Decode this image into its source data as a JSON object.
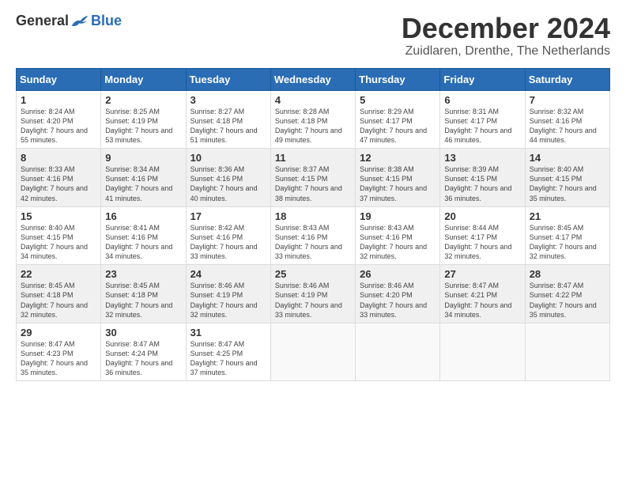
{
  "logo": {
    "general": "General",
    "blue": "Blue"
  },
  "header": {
    "month": "December 2024",
    "location": "Zuidlaren, Drenthe, The Netherlands"
  },
  "days": [
    "Sunday",
    "Monday",
    "Tuesday",
    "Wednesday",
    "Thursday",
    "Friday",
    "Saturday"
  ],
  "weeks": [
    [
      {
        "num": "1",
        "sunrise": "8:24 AM",
        "sunset": "4:20 PM",
        "daylight": "7 hours and 55 minutes."
      },
      {
        "num": "2",
        "sunrise": "8:25 AM",
        "sunset": "4:19 PM",
        "daylight": "7 hours and 53 minutes."
      },
      {
        "num": "3",
        "sunrise": "8:27 AM",
        "sunset": "4:18 PM",
        "daylight": "7 hours and 51 minutes."
      },
      {
        "num": "4",
        "sunrise": "8:28 AM",
        "sunset": "4:18 PM",
        "daylight": "7 hours and 49 minutes."
      },
      {
        "num": "5",
        "sunrise": "8:29 AM",
        "sunset": "4:17 PM",
        "daylight": "7 hours and 47 minutes."
      },
      {
        "num": "6",
        "sunrise": "8:31 AM",
        "sunset": "4:17 PM",
        "daylight": "7 hours and 46 minutes."
      },
      {
        "num": "7",
        "sunrise": "8:32 AM",
        "sunset": "4:16 PM",
        "daylight": "7 hours and 44 minutes."
      }
    ],
    [
      {
        "num": "8",
        "sunrise": "8:33 AM",
        "sunset": "4:16 PM",
        "daylight": "7 hours and 42 minutes."
      },
      {
        "num": "9",
        "sunrise": "8:34 AM",
        "sunset": "4:16 PM",
        "daylight": "7 hours and 41 minutes."
      },
      {
        "num": "10",
        "sunrise": "8:36 AM",
        "sunset": "4:16 PM",
        "daylight": "7 hours and 40 minutes."
      },
      {
        "num": "11",
        "sunrise": "8:37 AM",
        "sunset": "4:15 PM",
        "daylight": "7 hours and 38 minutes."
      },
      {
        "num": "12",
        "sunrise": "8:38 AM",
        "sunset": "4:15 PM",
        "daylight": "7 hours and 37 minutes."
      },
      {
        "num": "13",
        "sunrise": "8:39 AM",
        "sunset": "4:15 PM",
        "daylight": "7 hours and 36 minutes."
      },
      {
        "num": "14",
        "sunrise": "8:40 AM",
        "sunset": "4:15 PM",
        "daylight": "7 hours and 35 minutes."
      }
    ],
    [
      {
        "num": "15",
        "sunrise": "8:40 AM",
        "sunset": "4:15 PM",
        "daylight": "7 hours and 34 minutes."
      },
      {
        "num": "16",
        "sunrise": "8:41 AM",
        "sunset": "4:16 PM",
        "daylight": "7 hours and 34 minutes."
      },
      {
        "num": "17",
        "sunrise": "8:42 AM",
        "sunset": "4:16 PM",
        "daylight": "7 hours and 33 minutes."
      },
      {
        "num": "18",
        "sunrise": "8:43 AM",
        "sunset": "4:16 PM",
        "daylight": "7 hours and 33 minutes."
      },
      {
        "num": "19",
        "sunrise": "8:43 AM",
        "sunset": "4:16 PM",
        "daylight": "7 hours and 32 minutes."
      },
      {
        "num": "20",
        "sunrise": "8:44 AM",
        "sunset": "4:17 PM",
        "daylight": "7 hours and 32 minutes."
      },
      {
        "num": "21",
        "sunrise": "8:45 AM",
        "sunset": "4:17 PM",
        "daylight": "7 hours and 32 minutes."
      }
    ],
    [
      {
        "num": "22",
        "sunrise": "8:45 AM",
        "sunset": "4:18 PM",
        "daylight": "7 hours and 32 minutes."
      },
      {
        "num": "23",
        "sunrise": "8:45 AM",
        "sunset": "4:18 PM",
        "daylight": "7 hours and 32 minutes."
      },
      {
        "num": "24",
        "sunrise": "8:46 AM",
        "sunset": "4:19 PM",
        "daylight": "7 hours and 32 minutes."
      },
      {
        "num": "25",
        "sunrise": "8:46 AM",
        "sunset": "4:19 PM",
        "daylight": "7 hours and 33 minutes."
      },
      {
        "num": "26",
        "sunrise": "8:46 AM",
        "sunset": "4:20 PM",
        "daylight": "7 hours and 33 minutes."
      },
      {
        "num": "27",
        "sunrise": "8:47 AM",
        "sunset": "4:21 PM",
        "daylight": "7 hours and 34 minutes."
      },
      {
        "num": "28",
        "sunrise": "8:47 AM",
        "sunset": "4:22 PM",
        "daylight": "7 hours and 35 minutes."
      }
    ],
    [
      {
        "num": "29",
        "sunrise": "8:47 AM",
        "sunset": "4:23 PM",
        "daylight": "7 hours and 35 minutes."
      },
      {
        "num": "30",
        "sunrise": "8:47 AM",
        "sunset": "4:24 PM",
        "daylight": "7 hours and 36 minutes."
      },
      {
        "num": "31",
        "sunrise": "8:47 AM",
        "sunset": "4:25 PM",
        "daylight": "7 hours and 37 minutes."
      },
      null,
      null,
      null,
      null
    ]
  ]
}
